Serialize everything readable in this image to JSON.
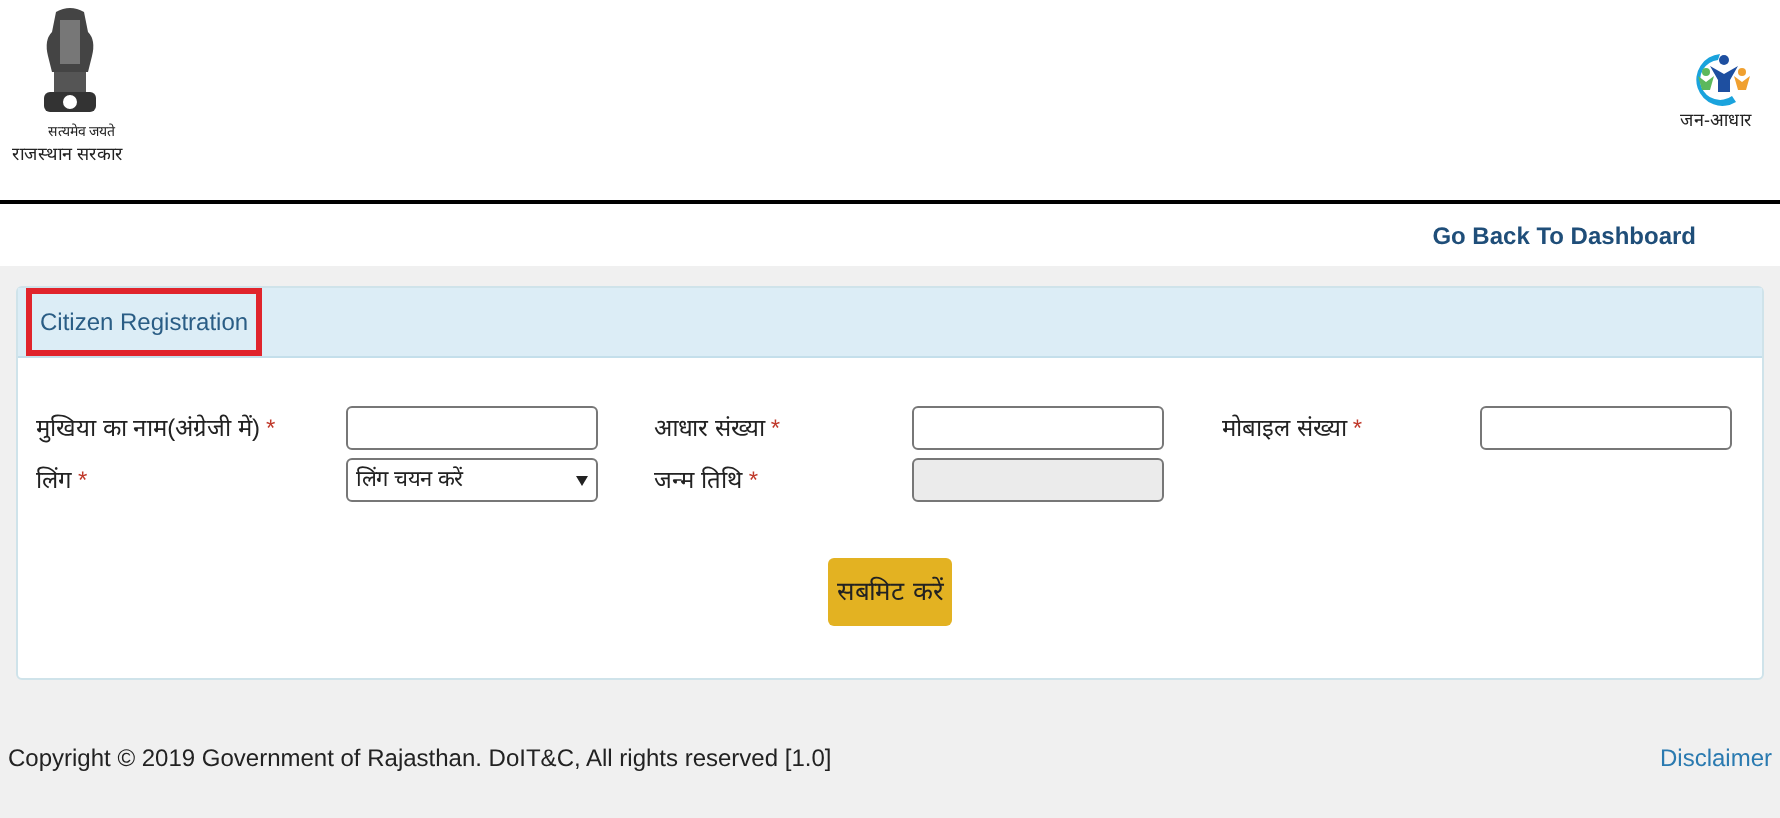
{
  "header": {
    "emblem_motto": "सत्यमेव जयते",
    "emblem_caption": "राजस्थान सरकार",
    "logo_caption": "जन-आधार"
  },
  "nav": {
    "link": "Go Back To Dashboard"
  },
  "panel": {
    "title": "Citizen Registration",
    "title_highlighted": true,
    "rows": [
      [
        {
          "label": "मुखिया का नाम(अंग्रेजी में)",
          "mark": "*",
          "kind": "input"
        },
        {
          "label": "आधार संख्या",
          "mark": "*",
          "kind": "input"
        },
        {
          "label": "मोबाइल संख्या",
          "mark": "*",
          "kind": "input"
        }
      ],
      [
        {
          "label": "लिंग",
          "mark": "*",
          "kind": "select",
          "value": "लिंग चयन करें"
        },
        {
          "label": "जन्म तिथि",
          "mark": "*",
          "kind": "date",
          "disabled": true
        }
      ]
    ],
    "submit": "सबमिट करें"
  },
  "footer": {
    "copyright": "Copyright © 2019 Government of Rajasthan. DoIT&C, All rights reserved [1.0]",
    "disclaimer": "Disclaimer"
  }
}
